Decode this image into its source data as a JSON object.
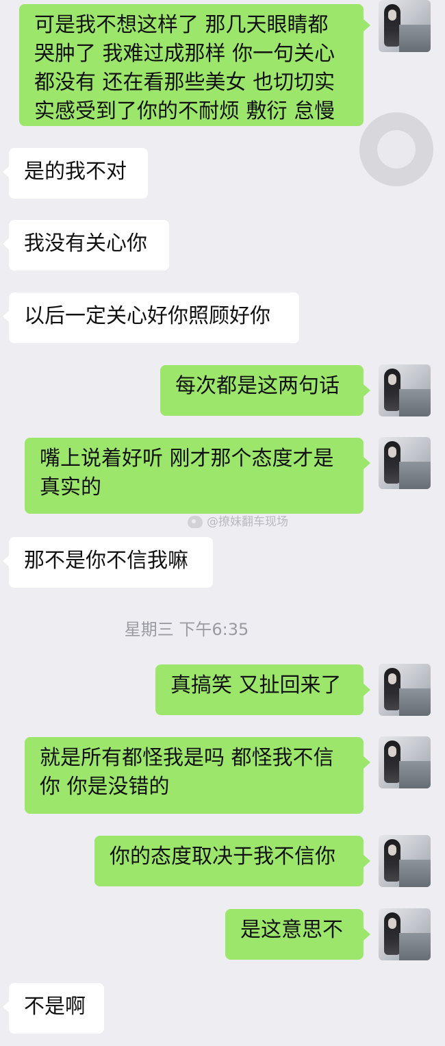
{
  "chat": {
    "messages": [
      {
        "id": "m1",
        "side": "sent",
        "text": "可是我不想这样了 那几天眼睛都哭肿了 我难过成那样 你一句关心都没有 还在看那些美女 也切切实实感受到了你的不耐烦 敷衍 怠慢"
      },
      {
        "id": "m2",
        "side": "received",
        "text": "是的我不对"
      },
      {
        "id": "m3",
        "side": "received",
        "text": "我没有关心你"
      },
      {
        "id": "m4",
        "side": "received",
        "text": "以后一定关心好你照顾好你"
      },
      {
        "id": "m5",
        "side": "sent",
        "text": "每次都是这两句话"
      },
      {
        "id": "m6",
        "side": "sent",
        "text": "嘴上说着好听 刚才那个态度才是真实的"
      },
      {
        "id": "m7",
        "side": "received",
        "text": "那不是你不信我嘛"
      },
      {
        "id": "m8",
        "side": "sent",
        "text": "真搞笑 又扯回来了"
      },
      {
        "id": "m9",
        "side": "sent",
        "text": "就是所有都怪我是吗 都怪我不信你 你是没错的"
      },
      {
        "id": "m10",
        "side": "sent",
        "text": "你的态度取决于我不信你"
      },
      {
        "id": "m11",
        "side": "sent",
        "text": "是这意思不"
      },
      {
        "id": "m12",
        "side": "received",
        "text": "不是啊"
      }
    ],
    "timestamp": "星期三 下午6:35",
    "watermark": "@撩妹翻车现场"
  },
  "icons": {
    "avatar": "avatar-icon",
    "partial_circle": "circle-icon",
    "weibo": "weibo-icon"
  },
  "colors": {
    "background": "#eeedf2",
    "sent_bubble": "#9de66c",
    "received_bubble": "#ffffff",
    "text": "#111111",
    "timestamp": "#9a9aa1"
  }
}
